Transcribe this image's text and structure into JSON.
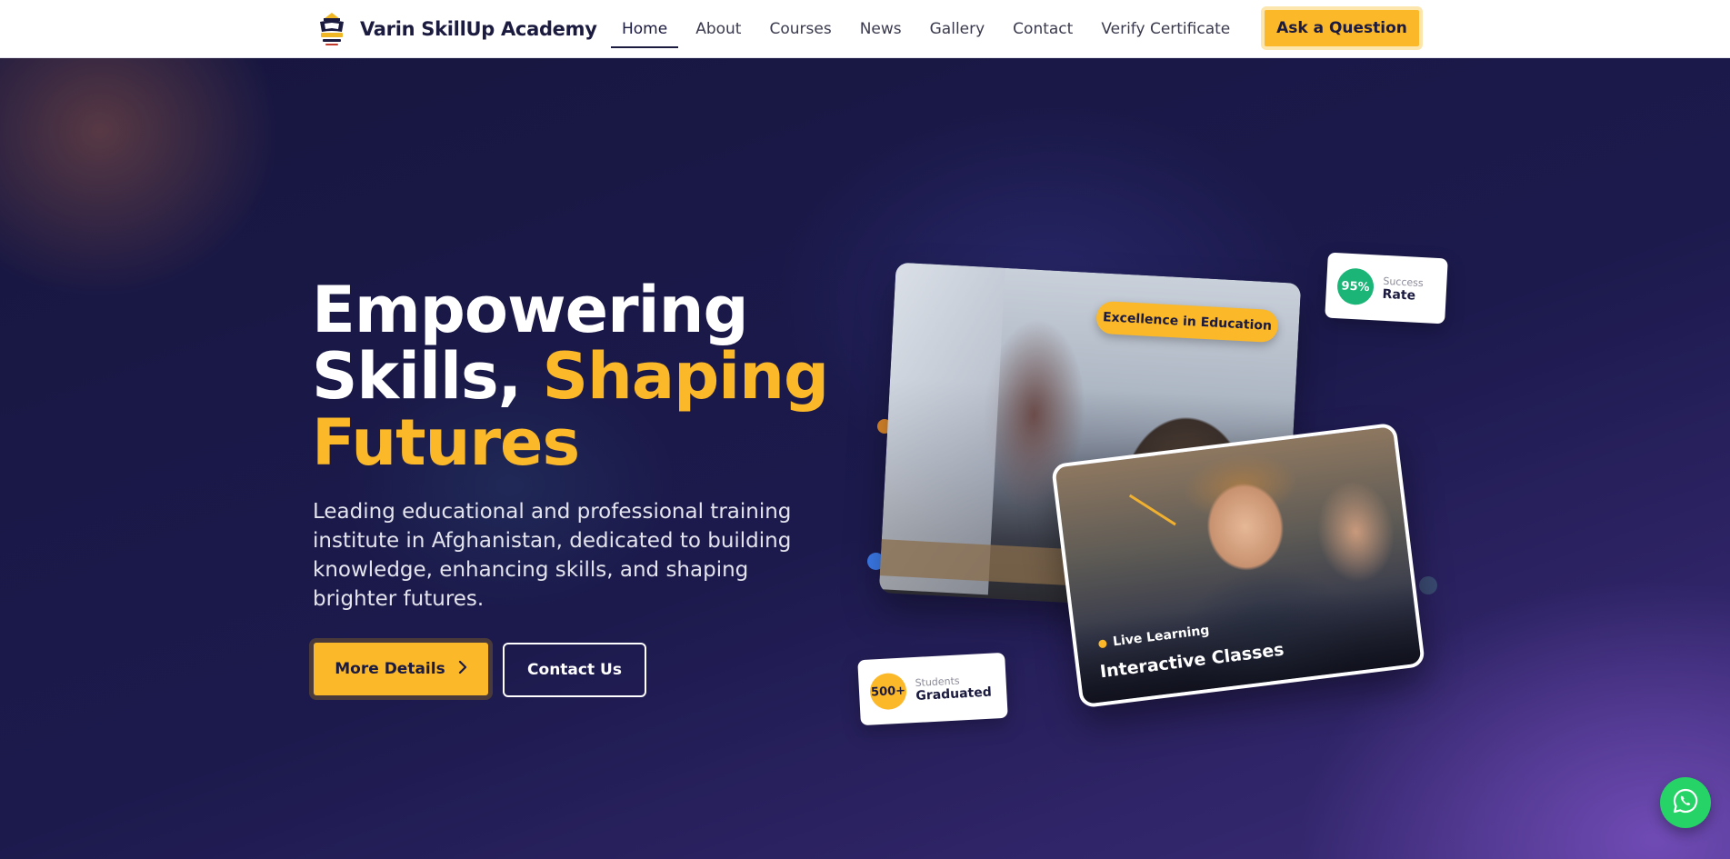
{
  "brand": {
    "name": "Varin SkillUp Academy"
  },
  "nav": {
    "items": [
      {
        "label": "Home",
        "active": true
      },
      {
        "label": "About",
        "active": false
      },
      {
        "label": "Courses",
        "active": false
      },
      {
        "label": "News",
        "active": false
      },
      {
        "label": "Gallery",
        "active": false
      },
      {
        "label": "Contact",
        "active": false
      },
      {
        "label": "Verify Certificate",
        "active": false
      }
    ],
    "cta_label": "Ask a Question"
  },
  "hero": {
    "headline_line1": "Empowering",
    "headline_line2_white": "Skills, ",
    "headline_line2_accent": "Shaping",
    "headline_line3_accent": "Futures",
    "subtext": "Leading educational and professional training institute in Afghanistan, dedicated to building knowledge, enhancing skills, and shaping brighter futures.",
    "primary_button": "More Details",
    "secondary_button": "Contact Us"
  },
  "media": {
    "badge_excellence": "Excellence in Education",
    "live_label": "Live Learning",
    "front_caption": "Interactive Classes"
  },
  "stats": {
    "success": {
      "value": "95%",
      "small": "Success",
      "big": "Rate"
    },
    "graduated": {
      "value": "500+",
      "small": "Students",
      "big": "Graduated"
    }
  },
  "icons": {
    "primary_arrow": "chevron-right-icon",
    "floating": "whatsapp-icon"
  },
  "colors": {
    "accent": "#fbb829",
    "navy": "#1b1a3f",
    "success_green": "#1bb577",
    "whatsapp_green": "#25d366"
  }
}
